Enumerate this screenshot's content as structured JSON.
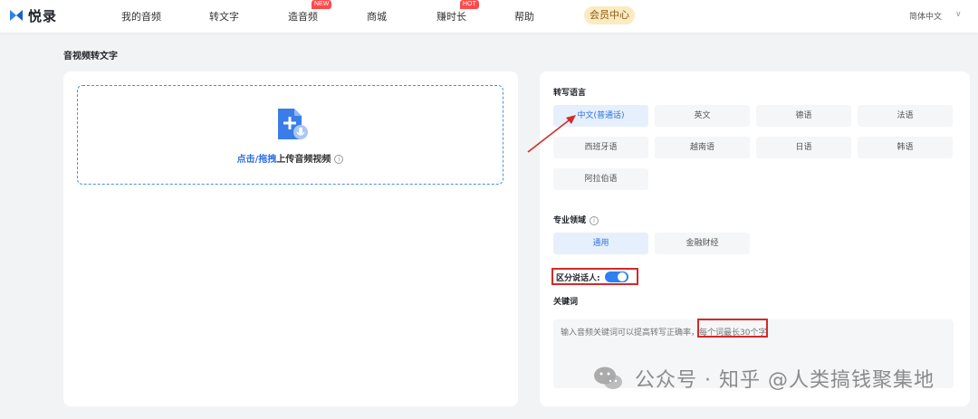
{
  "header": {
    "logo_text": "悦录",
    "nav": [
      {
        "label": "我的音频",
        "badge": ""
      },
      {
        "label": "转文字",
        "badge": ""
      },
      {
        "label": "造音频",
        "badge": "NEW"
      },
      {
        "label": "商城",
        "badge": ""
      },
      {
        "label": "赚时长",
        "badge": "HOT"
      },
      {
        "label": "帮助",
        "badge": ""
      }
    ],
    "vip_label": "会员中心",
    "language": "简体中文",
    "caret": "∨"
  },
  "page_title": "音视频转文字",
  "upload": {
    "link_text": "点击/拖拽",
    "text": "上传音频视频",
    "info": "i"
  },
  "transcribe": {
    "section_label": "转写语言",
    "languages": [
      "中文(普通话)",
      "英文",
      "德语",
      "法语",
      "西班牙语",
      "越南语",
      "日语",
      "韩语",
      "阿拉伯语"
    ],
    "selected": "中文(普通话)"
  },
  "domain": {
    "section_label": "专业领域",
    "info": "i",
    "options": [
      "通用",
      "金融财经"
    ],
    "selected": "通用"
  },
  "speaker": {
    "label": "区分说话人:",
    "enabled": true
  },
  "keywords": {
    "section_label": "关键词",
    "placeholder": "输入音频关键词可以提高转写正确率，每个词最长30个字"
  },
  "watermark": {
    "text": "公众号 · 知乎 @人类搞钱聚集地"
  },
  "colors": {
    "accent": "#2f7ff0",
    "annotation_red": "#d42a2a",
    "vip_bg": "#fbeac2",
    "badge_red": "#ff4b4b"
  }
}
